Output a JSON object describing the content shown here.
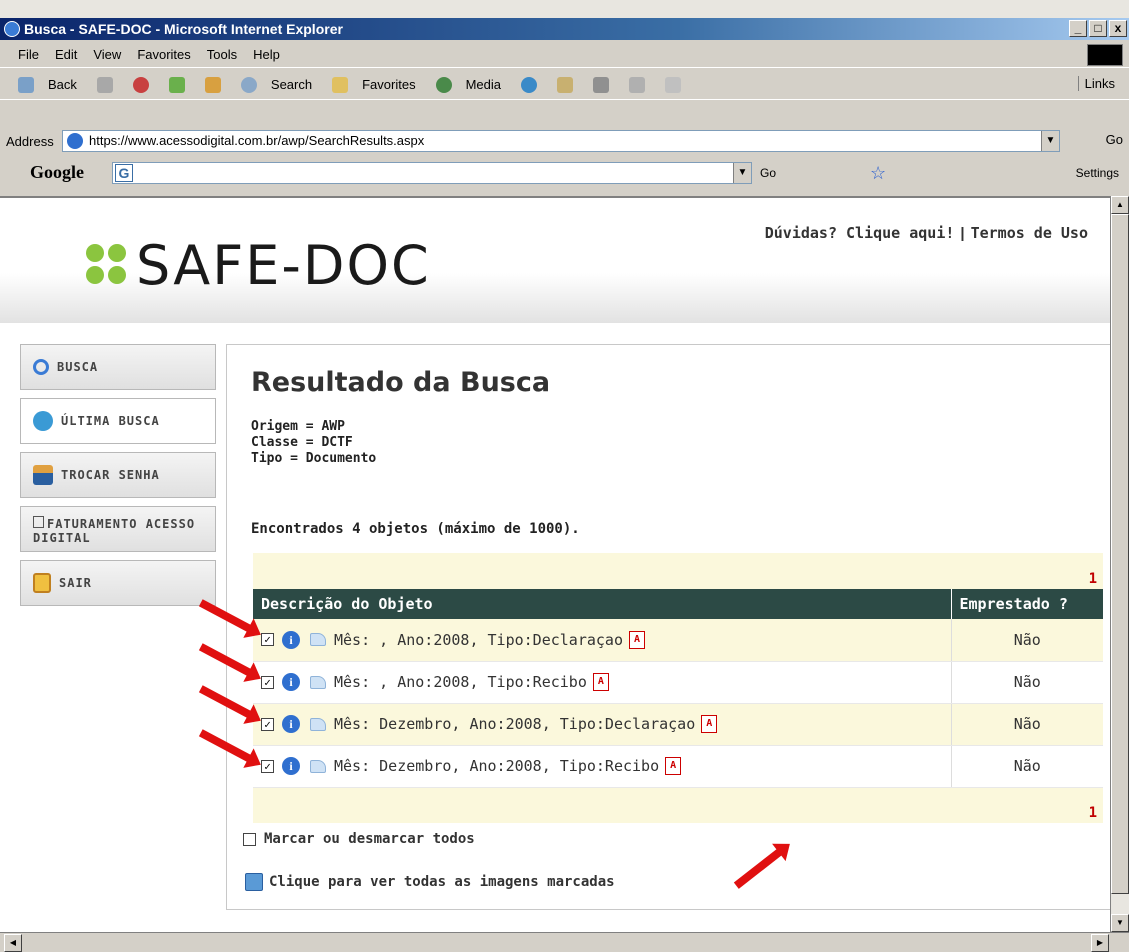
{
  "window": {
    "title": "Busca - SAFE-DOC - Microsoft Internet Explorer",
    "min": "_",
    "max": "□",
    "close": "x"
  },
  "menu": [
    "File",
    "Edit",
    "View",
    "Favorites",
    "Tools",
    "Help"
  ],
  "toolbar": {
    "back": "Back",
    "search": "Search",
    "favorites": "Favorites",
    "media": "Media",
    "links": "Links"
  },
  "address": {
    "label": "Address",
    "url": "https://www.acessodigital.com.br/awp/SearchResults.aspx",
    "go": "Go"
  },
  "google": {
    "logo": "Google",
    "go": "Go",
    "settings": "Settings"
  },
  "site": {
    "logo": "SAFE-DOC",
    "help_link": "Dúvidas? Clique aqui!",
    "separator": "|",
    "terms_link": "Termos de Uso"
  },
  "nav": [
    {
      "label": "BUSCA",
      "icon": "magnifier-icon"
    },
    {
      "label": "ÚLTIMA BUSCA",
      "icon": "last-search-icon"
    },
    {
      "label": "TROCAR SENHA",
      "icon": "user-icon"
    },
    {
      "label": "FATURAMENTO ACESSO DIGITAL",
      "icon": "document-icon"
    },
    {
      "label": "SAIR",
      "icon": "exit-door-icon"
    }
  ],
  "results": {
    "title": "Resultado da Busca",
    "criteria": [
      "Origem = AWP",
      "Classe = DCTF",
      "Tipo = Documento"
    ],
    "found": "Encontrados 4 objetos (máximo de 1000).",
    "page_top": "1",
    "page_bottom": "1",
    "columns": [
      "Descrição do Objeto",
      "Emprestado ?"
    ],
    "rows": [
      {
        "description": "Mês: , Ano:2008, Tipo:Declaraçao",
        "lent": "Não",
        "checked": true
      },
      {
        "description": "Mês: , Ano:2008, Tipo:Recibo",
        "lent": "Não",
        "checked": true
      },
      {
        "description": "Mês: Dezembro, Ano:2008, Tipo:Declaraçao",
        "lent": "Não",
        "checked": true
      },
      {
        "description": "Mês: Dezembro, Ano:2008, Tipo:Recibo",
        "lent": "Não",
        "checked": true
      }
    ],
    "mark_all": "Marcar ou desmarcar todos",
    "view_all": "Clique para ver todas as imagens marcadas"
  },
  "colors": {
    "header_row": "#2c4a45",
    "highlight_row": "#fbf8dc",
    "arrow": "#e01010",
    "logo_mark": "#8bc53f"
  }
}
